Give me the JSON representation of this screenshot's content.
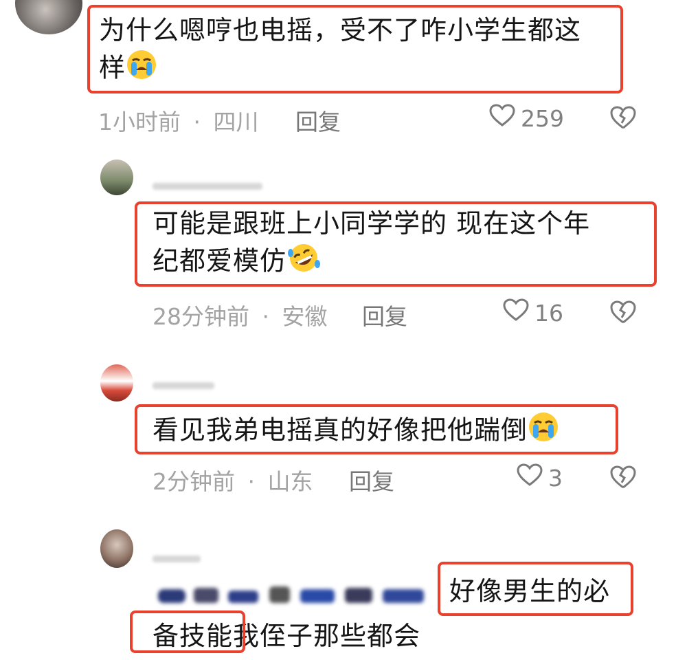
{
  "comments": [
    {
      "text_lines": [
        "为什么嗯哼也电摇，受不了咋小学生都这",
        "样"
      ],
      "time": "1小时前",
      "region": "四川",
      "reply_label": "回复",
      "likes": "259",
      "emoji": "loudly-crying-face"
    },
    {
      "text_lines": [
        "可能是跟班上小同学学的 现在这个年",
        "纪都爱模仿"
      ],
      "time": "28分钟前",
      "region": "安徽",
      "reply_label": "回复",
      "likes": "16",
      "emoji": "rolling-on-floor-laughing-face"
    },
    {
      "text_lines": [
        "看见我弟电摇真的好像把他踹倒"
      ],
      "time": "2分钟前",
      "region": "山东",
      "reply_label": "回复",
      "likes": "3",
      "emoji": "loudly-crying-face"
    },
    {
      "text_lines": [
        "好像男生的必",
        "备技能我侄子那些都会"
      ]
    }
  ],
  "separator": "·",
  "colors": {
    "highlight": "#e8412d",
    "meta": "#a3a3a3",
    "text": "#151515"
  }
}
